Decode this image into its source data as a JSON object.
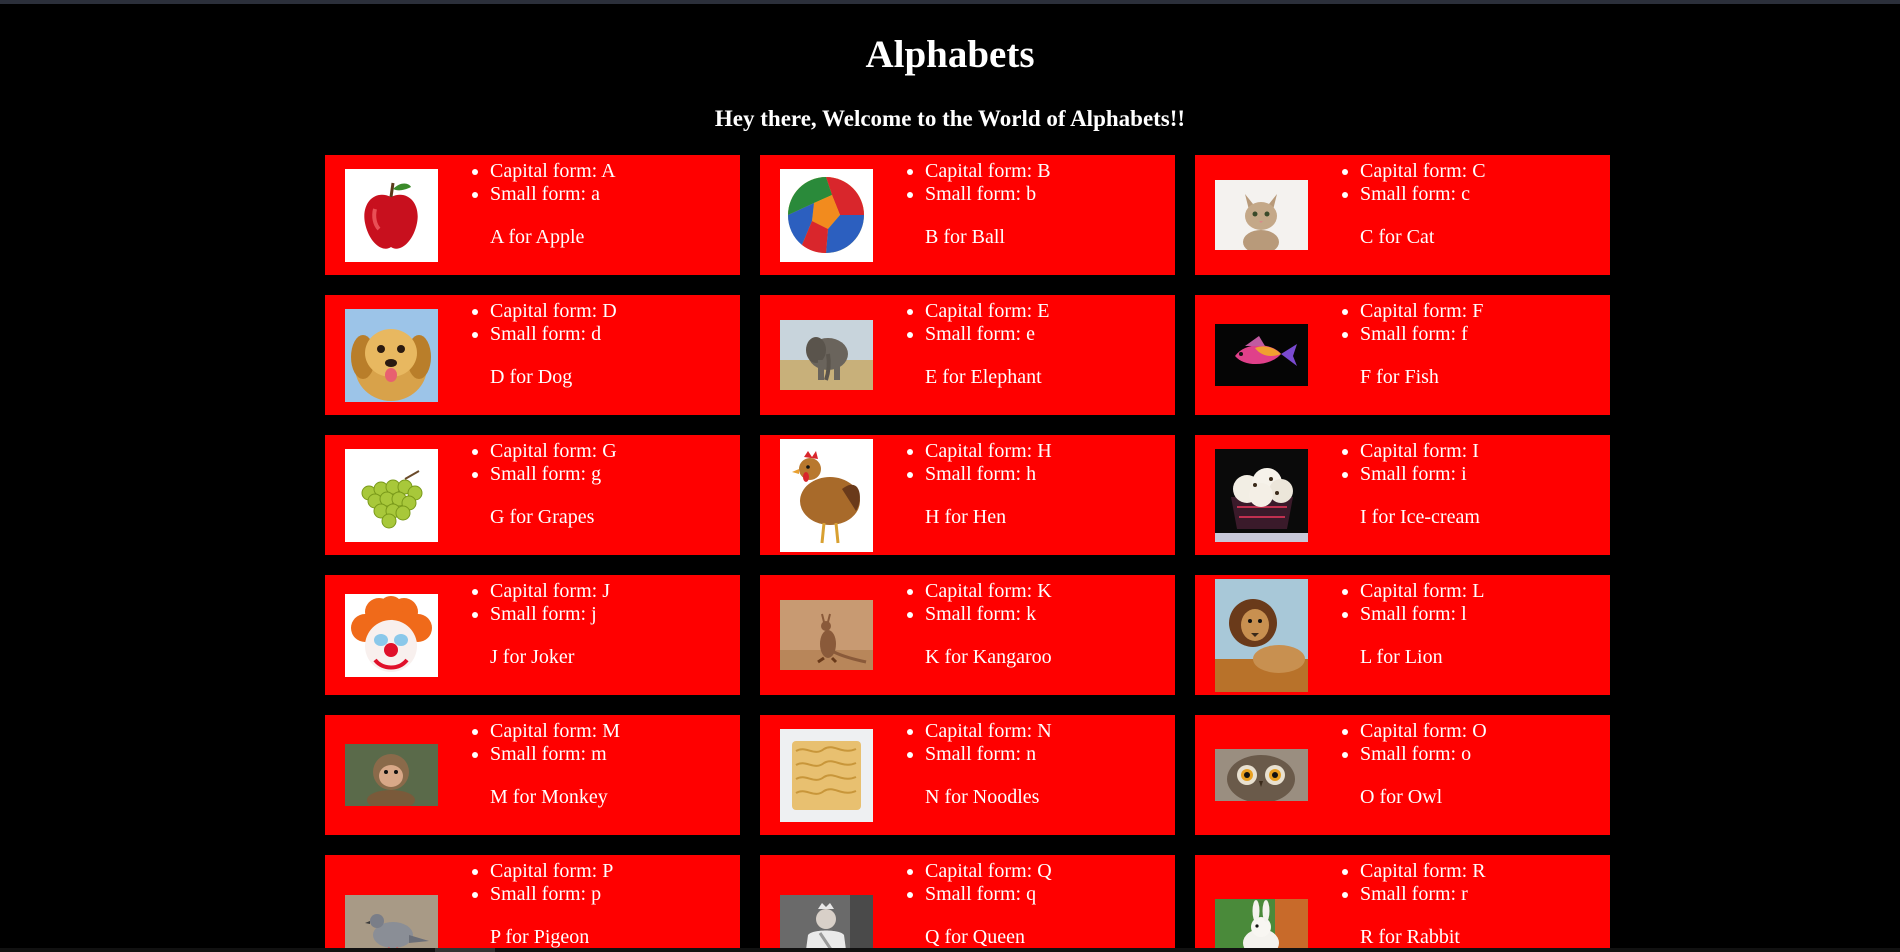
{
  "header": {
    "title": "Alphabets",
    "subtitle": "Hey there, Welcome to the World of Alphabets!!"
  },
  "colors": {
    "background": "#000000",
    "card": "#ff0000",
    "text": "#ffffff"
  },
  "cards": [
    {
      "capital": "Capital form: A",
      "small": "Small form: a",
      "word": "A for Apple",
      "image": "apple-image"
    },
    {
      "capital": "Capital form: B",
      "small": "Small form: b",
      "word": "B for Ball",
      "image": "ball-image"
    },
    {
      "capital": "Capital form: C",
      "small": "Small form: c",
      "word": "C for Cat",
      "image": "cat-image"
    },
    {
      "capital": "Capital form: D",
      "small": "Small form: d",
      "word": "D for Dog",
      "image": "dog-image"
    },
    {
      "capital": "Capital form: E",
      "small": "Small form: e",
      "word": "E for Elephant",
      "image": "elephant-image"
    },
    {
      "capital": "Capital form: F",
      "small": "Small form: f",
      "word": "F for Fish",
      "image": "fish-image"
    },
    {
      "capital": "Capital form: G",
      "small": "Small form: g",
      "word": "G for Grapes",
      "image": "grapes-image"
    },
    {
      "capital": "Capital form: H",
      "small": "Small form: h",
      "word": "H for Hen",
      "image": "hen-image"
    },
    {
      "capital": "Capital form: I",
      "small": "Small form: i",
      "word": "I for Ice-cream",
      "image": "ice-cream-image"
    },
    {
      "capital": "Capital form: J",
      "small": "Small form: j",
      "word": "J for Joker",
      "image": "joker-image"
    },
    {
      "capital": "Capital form: K",
      "small": "Small form: k",
      "word": "K for Kangaroo",
      "image": "kangaroo-image"
    },
    {
      "capital": "Capital form: L",
      "small": "Small form: l",
      "word": "L for Lion",
      "image": "lion-image"
    },
    {
      "capital": "Capital form: M",
      "small": "Small form: m",
      "word": "M for Monkey",
      "image": "monkey-image"
    },
    {
      "capital": "Capital form: N",
      "small": "Small form: n",
      "word": "N for Noodles",
      "image": "noodles-image"
    },
    {
      "capital": "Capital form: O",
      "small": "Small form: o",
      "word": "O for Owl",
      "image": "owl-image"
    },
    {
      "capital": "Capital form: P",
      "small": "Small form: p",
      "word": "P for Pigeon",
      "image": "pigeon-image"
    },
    {
      "capital": "Capital form: Q",
      "small": "Small form: q",
      "word": "Q for Queen",
      "image": "queen-image"
    },
    {
      "capital": "Capital form: R",
      "small": "Small form: r",
      "word": "R for Rabbit",
      "image": "rabbit-image"
    }
  ]
}
